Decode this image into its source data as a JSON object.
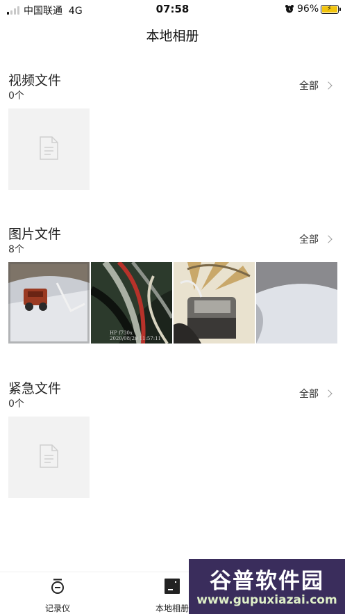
{
  "status_bar": {
    "carrier": "中国联通",
    "network": "4G",
    "time": "07:58",
    "battery": "96%"
  },
  "page": {
    "title": "本地相册"
  },
  "sections": [
    {
      "title": "视频文件",
      "count": "0个",
      "see_all": "全部"
    },
    {
      "title": "图片文件",
      "count": "8个",
      "see_all": "全部",
      "thumbnail_stamp": [
        "HP f730x",
        "2020/08/29 11:57:11"
      ]
    },
    {
      "title": "紧急文件",
      "count": "0个",
      "see_all": "全部"
    }
  ],
  "tab_bar": [
    {
      "label": "记录仪",
      "icon": "dashcam-icon"
    },
    {
      "label": "本地相册",
      "icon": "album-icon"
    }
  ],
  "watermark": {
    "line1": "谷普软件园",
    "line2": "www.gupuxiazai.com"
  },
  "colors": {
    "placeholder": "#f2f2f2",
    "battery": "#f2c40d"
  }
}
